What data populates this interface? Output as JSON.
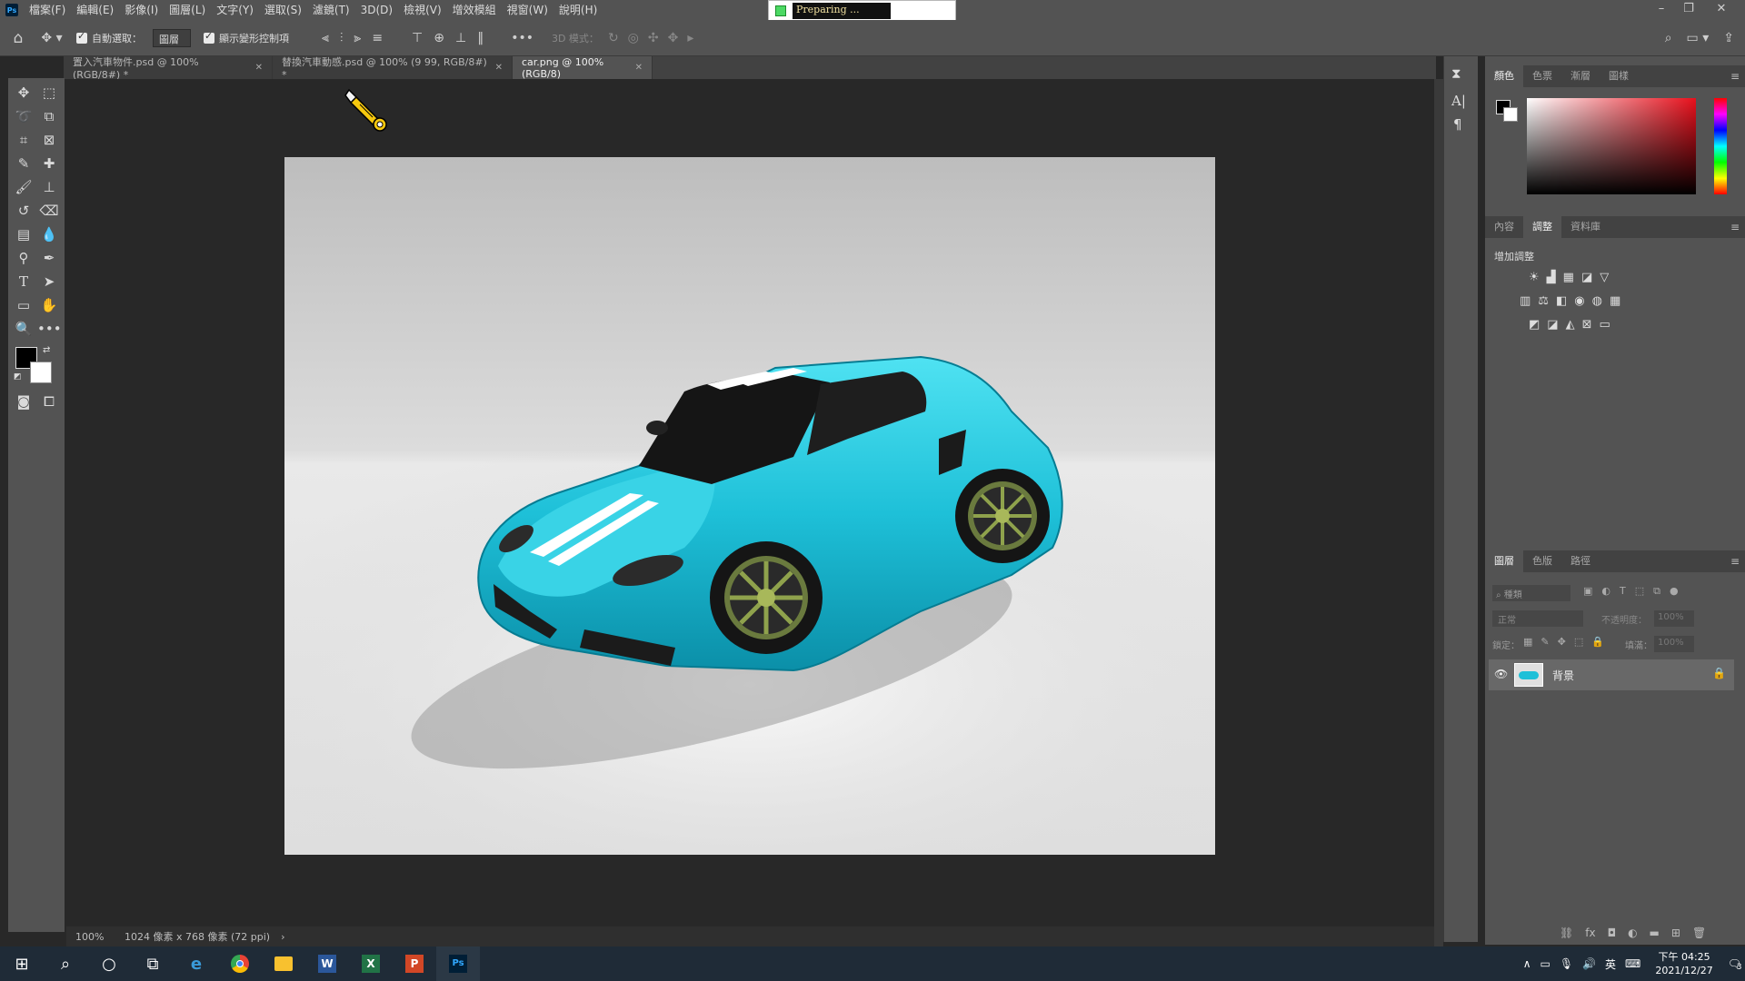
{
  "menubar": {
    "logo": "Ps",
    "items": [
      "檔案(F)",
      "編輯(E)",
      "影像(I)",
      "圖層(L)",
      "文字(Y)",
      "選取(S)",
      "濾鏡(T)",
      "3D(D)",
      "檢視(V)",
      "增效模組",
      "視窗(W)",
      "說明(H)"
    ],
    "progress_text": "Preparing ..."
  },
  "options": {
    "auto_select_label": "自動選取：",
    "auto_select_value": "圖層",
    "show_transform_label": "顯示變形控制項",
    "mode_3d_label": "3D 模式："
  },
  "tabs": [
    {
      "label": "置入汽車物件.psd @ 100% (RGB/8#) *",
      "active": false
    },
    {
      "label": "替換汽車動感.psd @ 100% (9 99, RGB/8#) *",
      "active": false
    },
    {
      "label": "car.png @ 100% (RGB/8)",
      "active": true
    }
  ],
  "status": {
    "zoom": "100%",
    "info": "1024 像素 x 768 像素 (72 ppi)",
    "arrow": "›"
  },
  "color_panel": {
    "tabs": [
      "顏色",
      "色票",
      "漸層",
      "圖樣"
    ]
  },
  "adjust_panel": {
    "tabs": [
      "內容",
      "調整",
      "資料庫"
    ],
    "title": "增加調整"
  },
  "layers_panel": {
    "tabs": [
      "圖層",
      "色版",
      "路徑"
    ],
    "search_placeholder": "種類",
    "blend_mode": "正常",
    "opacity_label": "不透明度：",
    "opacity_value": "100%",
    "lock_label": "鎖定：",
    "fill_label": "填滿：",
    "fill_value": "100%",
    "layer_name": "背景"
  },
  "taskbar": {
    "ime": "英",
    "time": "下午 04:25",
    "date": "2021/12/27",
    "notif_count": "3"
  },
  "colors": {
    "car_body": "#1ec0d8",
    "ui_bg": "#535353",
    "canvas_bg": "#282828"
  }
}
